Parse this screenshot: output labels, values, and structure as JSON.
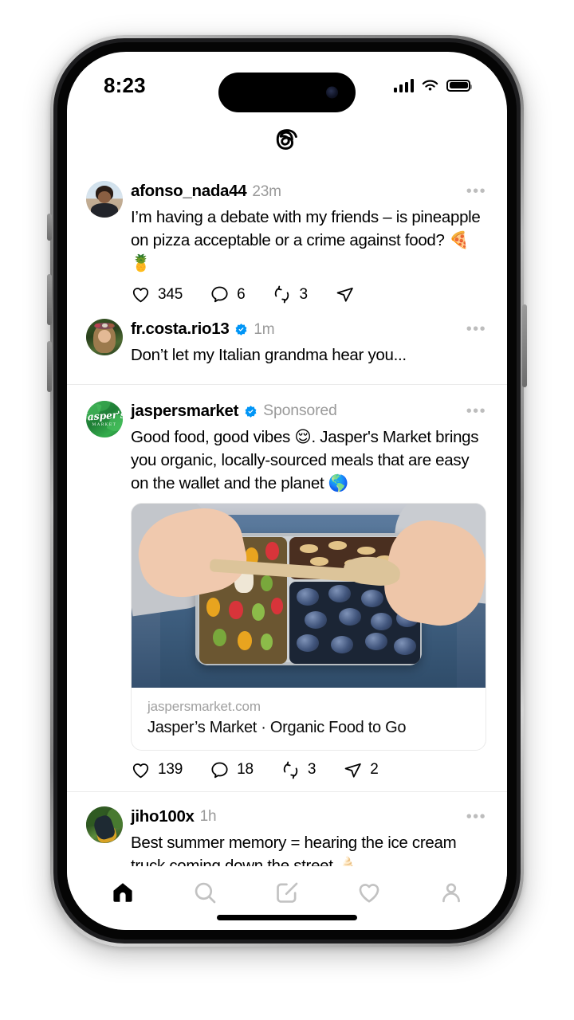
{
  "status_bar": {
    "time": "8:23",
    "cellular_icon": "signal-bars-icon",
    "wifi_icon": "wifi-icon",
    "battery_icon": "battery-icon"
  },
  "app_header": {
    "logo_icon": "threads-logo-icon",
    "app_name": "Threads"
  },
  "feed": {
    "posts": [
      {
        "id": "post-afonso",
        "username": "afonso_nada44",
        "verified": false,
        "timestamp": "23m",
        "avatar_icon": "avatar-afonso",
        "more_icon": "more-options-icon",
        "text": "I’m having a debate with my friends – is pineapple on pizza acceptable or a crime against food? 🍕🍍",
        "has_thread_line": true,
        "actions": [
          {
            "name": "like",
            "icon": "heart-icon",
            "count": "345"
          },
          {
            "name": "reply",
            "icon": "comment-icon",
            "count": "6"
          },
          {
            "name": "repost",
            "icon": "repost-icon",
            "count": "3"
          },
          {
            "name": "share",
            "icon": "share-icon",
            "count": ""
          }
        ]
      },
      {
        "id": "post-frcosta",
        "username": "fr.costa.rio13",
        "verified": true,
        "timestamp": "1m",
        "avatar_icon": "avatar-frcosta",
        "more_icon": "more-options-icon",
        "text": "Don’t let my Italian grandma hear you...",
        "has_thread_line": false,
        "actions": []
      },
      {
        "id": "post-jaspersmarket",
        "username": "jaspersmarket",
        "verified": true,
        "timestamp": "Sponsored",
        "is_sponsored": true,
        "avatar_icon": "avatar-jaspersmarket",
        "more_icon": "more-options-icon",
        "text": "Good food, good vibes 😌. Jasper's Market brings you organic, locally-sourced meals that are easy on the wallet and the planet 🌎",
        "has_thread_line": false,
        "link_card": {
          "image_alt": "hands-holding-bento-lunchbox-image",
          "domain": "jaspersmarket.com",
          "title": "Jasper’s Market · Organic Food to Go"
        },
        "actions": [
          {
            "name": "like",
            "icon": "heart-icon",
            "count": "139"
          },
          {
            "name": "reply",
            "icon": "comment-icon",
            "count": "18"
          },
          {
            "name": "repost",
            "icon": "repost-icon",
            "count": "3"
          },
          {
            "name": "share",
            "icon": "share-icon",
            "count": "2"
          }
        ]
      },
      {
        "id": "post-jiho",
        "username": "jiho100x",
        "verified": false,
        "timestamp": "1h",
        "avatar_icon": "avatar-jiho",
        "more_icon": "more-options-icon",
        "text": "Best summer memory = hearing the ice cream truck coming down the street 🍦",
        "has_thread_line": false,
        "actions": []
      }
    ]
  },
  "tab_bar": {
    "tabs": [
      {
        "name": "home",
        "icon": "home-icon",
        "label": "Home",
        "active": true
      },
      {
        "name": "search",
        "icon": "search-icon",
        "label": "Search",
        "active": false
      },
      {
        "name": "compose",
        "icon": "compose-icon",
        "label": "Compose",
        "active": false
      },
      {
        "name": "activity",
        "icon": "heart-icon",
        "label": "Activity",
        "active": false
      },
      {
        "name": "profile",
        "icon": "profile-icon",
        "label": "Profile",
        "active": false
      }
    ]
  },
  "colors": {
    "verified_blue": "#0095F6",
    "active_tab": "#000000",
    "inactive_tab": "#c2c2c2",
    "secondary_text": "#999999",
    "divider": "#ebebeb",
    "brand_green": "#2e9b45"
  }
}
